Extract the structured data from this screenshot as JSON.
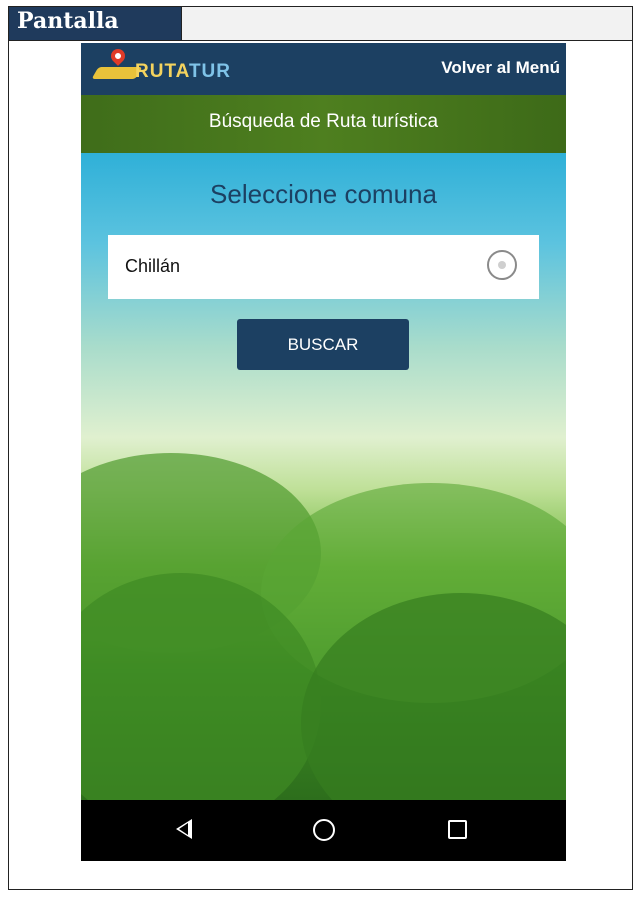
{
  "header": {
    "label": "Pantalla"
  },
  "app": {
    "logo_text_1": "RUTA",
    "logo_text_2": "TUR",
    "menu_link": "Volver al Menú",
    "subtitle": "Búsqueda de Ruta turística"
  },
  "main": {
    "title": "Seleccione comuna",
    "selected_comuna": "Chillán",
    "search_button": "BUSCAR"
  },
  "colors": {
    "header_bg": "#1f3a5c",
    "appbar_bg": "#1c4062",
    "subbar_bg": "#4e7f1f",
    "button_bg": "#1c4062"
  },
  "icons": {
    "nav_back": "back-triangle-icon",
    "nav_home": "home-circle-icon",
    "nav_recent": "recent-square-icon",
    "radio": "radio-button-icon",
    "logo_pin": "map-pin-icon"
  }
}
